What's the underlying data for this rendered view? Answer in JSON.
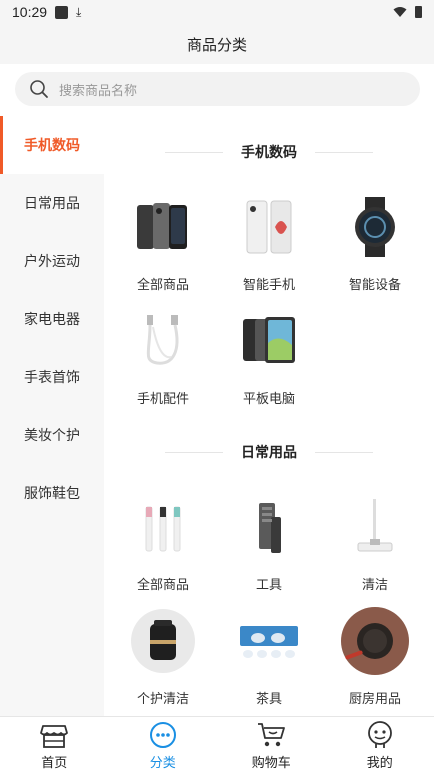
{
  "status": {
    "time": "10:29"
  },
  "header": {
    "title": "商品分类"
  },
  "search": {
    "placeholder": "搜索商品名称"
  },
  "sidebar": {
    "items": [
      {
        "label": "手机数码"
      },
      {
        "label": "日常用品"
      },
      {
        "label": "户外运动"
      },
      {
        "label": "家电电器"
      },
      {
        "label": "手表首饰"
      },
      {
        "label": "美妆个护"
      },
      {
        "label": "服饰鞋包"
      }
    ]
  },
  "sections": [
    {
      "title": "手机数码",
      "items": [
        {
          "label": "全部商品",
          "icon": "phones-image"
        },
        {
          "label": "智能手机",
          "icon": "smartphone-image"
        },
        {
          "label": "智能设备",
          "icon": "smartwatch-image"
        },
        {
          "label": "手机配件",
          "icon": "cable-image"
        },
        {
          "label": "平板电脑",
          "icon": "tablet-image"
        }
      ]
    },
    {
      "title": "日常用品",
      "items": [
        {
          "label": "全部商品",
          "icon": "toothbrush-heads-image"
        },
        {
          "label": "工具",
          "icon": "screwdriver-kit-image"
        },
        {
          "label": "清洁",
          "icon": "mop-image"
        },
        {
          "label": "个护清洁",
          "icon": "personal-care-image"
        },
        {
          "label": "茶具",
          "icon": "tea-set-image"
        },
        {
          "label": "厨房用品",
          "icon": "cookware-image"
        }
      ]
    }
  ],
  "bottom_nav": [
    {
      "label": "首页",
      "icon": "shop-icon"
    },
    {
      "label": "分类",
      "icon": "category-dots-icon"
    },
    {
      "label": "购物车",
      "icon": "cart-icon"
    },
    {
      "label": "我的",
      "icon": "profile-icon"
    }
  ],
  "colors": {
    "accent": "#f05a28",
    "nav_active": "#1a8fe3"
  }
}
